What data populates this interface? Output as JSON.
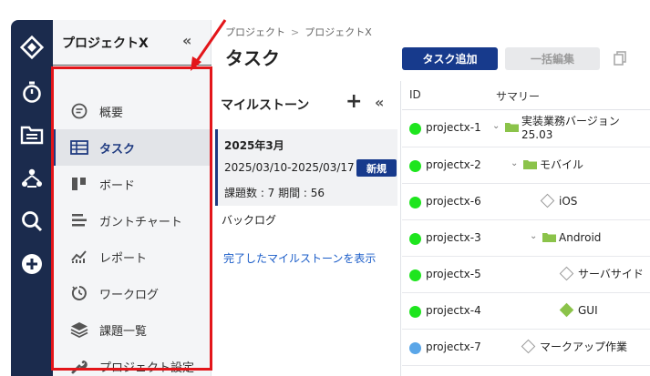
{
  "colors": {
    "rail": "#1b2b4d",
    "accent": "#173a8c",
    "green_status": "#1ee51e",
    "blue_status": "#5aa6e8",
    "folder": "#8bc34a",
    "link": "#1a5cc8",
    "annotation_red": "#e3151a"
  },
  "rail_icons": [
    "logo-diamond-icon",
    "stopwatch-icon",
    "folder-list-icon",
    "team-icon",
    "search-icon",
    "add-circle-icon"
  ],
  "sidebar": {
    "project_title": "プロジェクトX",
    "collapse_glyph": "«",
    "items": [
      {
        "label": "概要",
        "icon": "summary-icon"
      },
      {
        "label": "タスク",
        "icon": "table-icon",
        "active": true
      },
      {
        "label": "ボード",
        "icon": "board-icon"
      },
      {
        "label": "ガントチャート",
        "icon": "gantt-icon"
      },
      {
        "label": "レポート",
        "icon": "report-chart-icon"
      },
      {
        "label": "ワークログ",
        "icon": "worklog-icon"
      },
      {
        "label": "課題一覧",
        "icon": "layers-icon"
      },
      {
        "label": "プロジェクト設定",
        "icon": "wrench-icon"
      }
    ]
  },
  "header": {
    "breadcrumb": [
      "プロジェクト",
      "プロジェクトX"
    ],
    "breadcrumb_sep": ">",
    "title": "タスク",
    "add_task": "タスク追加",
    "bulk_edit": "一括編集"
  },
  "milestones": {
    "heading": "マイルストーン",
    "plus": "+",
    "collapse": "«",
    "card": {
      "name": "2025年3月",
      "dates": "2025/03/10-2025/03/17",
      "badge": "新規",
      "count": "課題数 : 7 期間 : 56"
    },
    "backlog": "バックログ",
    "show_completed": "完了したマイルストーンを表示"
  },
  "table": {
    "columns": [
      "ID",
      "サマリー"
    ],
    "rows": [
      {
        "id": "projectx-1",
        "status": "green",
        "type": "folder",
        "indent": 0,
        "chevron": true,
        "summary": "実装業務バージョン25.03"
      },
      {
        "id": "projectx-2",
        "status": "green",
        "type": "folder",
        "indent": 1,
        "chevron": true,
        "summary": "モバイル"
      },
      {
        "id": "projectx-6",
        "status": "green",
        "type": "task-outline",
        "indent": 2,
        "chevron": false,
        "summary": "iOS"
      },
      {
        "id": "projectx-3",
        "status": "green",
        "type": "folder",
        "indent": 2,
        "chevron": true,
        "summary": "Android"
      },
      {
        "id": "projectx-5",
        "status": "green",
        "type": "task-outline",
        "indent": 3,
        "chevron": false,
        "summary": "サーバサイド"
      },
      {
        "id": "projectx-4",
        "status": "green",
        "type": "task-filled",
        "indent": 3,
        "chevron": false,
        "summary": "GUI"
      },
      {
        "id": "projectx-7",
        "status": "blue",
        "type": "task-outline",
        "indent": 1,
        "chevron": false,
        "summary": "マークアップ作業"
      }
    ]
  }
}
